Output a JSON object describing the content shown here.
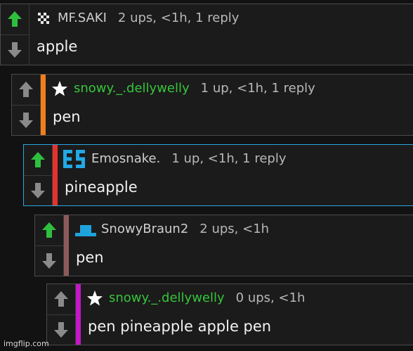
{
  "comments": [
    {
      "username": "MF.SAKI",
      "stats": "2 ups, <1h, 1 reply",
      "text": "apple",
      "avatar_icon": "checker-avatar-icon",
      "username_color": "#cfcfcf",
      "stripe_color": ""
    },
    {
      "username": "snowy._.dellywelly",
      "stats": "1 up, <1h, 1 reply",
      "text": "pen",
      "avatar_icon": "star-avatar-icon",
      "username_color": "#35c53a",
      "stripe_color": "#f07f1a"
    },
    {
      "username": "Emosnake.",
      "stats": "1 up, <1h, 1 reply",
      "text": "pineapple",
      "avatar_icon": "es-logo-avatar-icon",
      "username_color": "#cfcfcf",
      "stripe_color": "#e5322d"
    },
    {
      "username": "SnowyBraun2",
      "stats": "2 ups, <1h",
      "text": "pen",
      "avatar_icon": "cyan-hat-avatar-icon",
      "username_color": "#cfcfcf",
      "stripe_color": "#8d5a5a"
    },
    {
      "username": "snowy._.dellywelly",
      "stats": "0 ups, <1h",
      "text": "pen pineapple apple pen",
      "avatar_icon": "star-avatar-icon",
      "username_color": "#35c53a",
      "stripe_color": "#c418c4"
    }
  ],
  "watermark": "imgflip.com",
  "colors": {
    "upvote_active": "#2fbf3f",
    "vote_inactive": "#8a8a8a",
    "selected_border": "#2aa7df"
  }
}
